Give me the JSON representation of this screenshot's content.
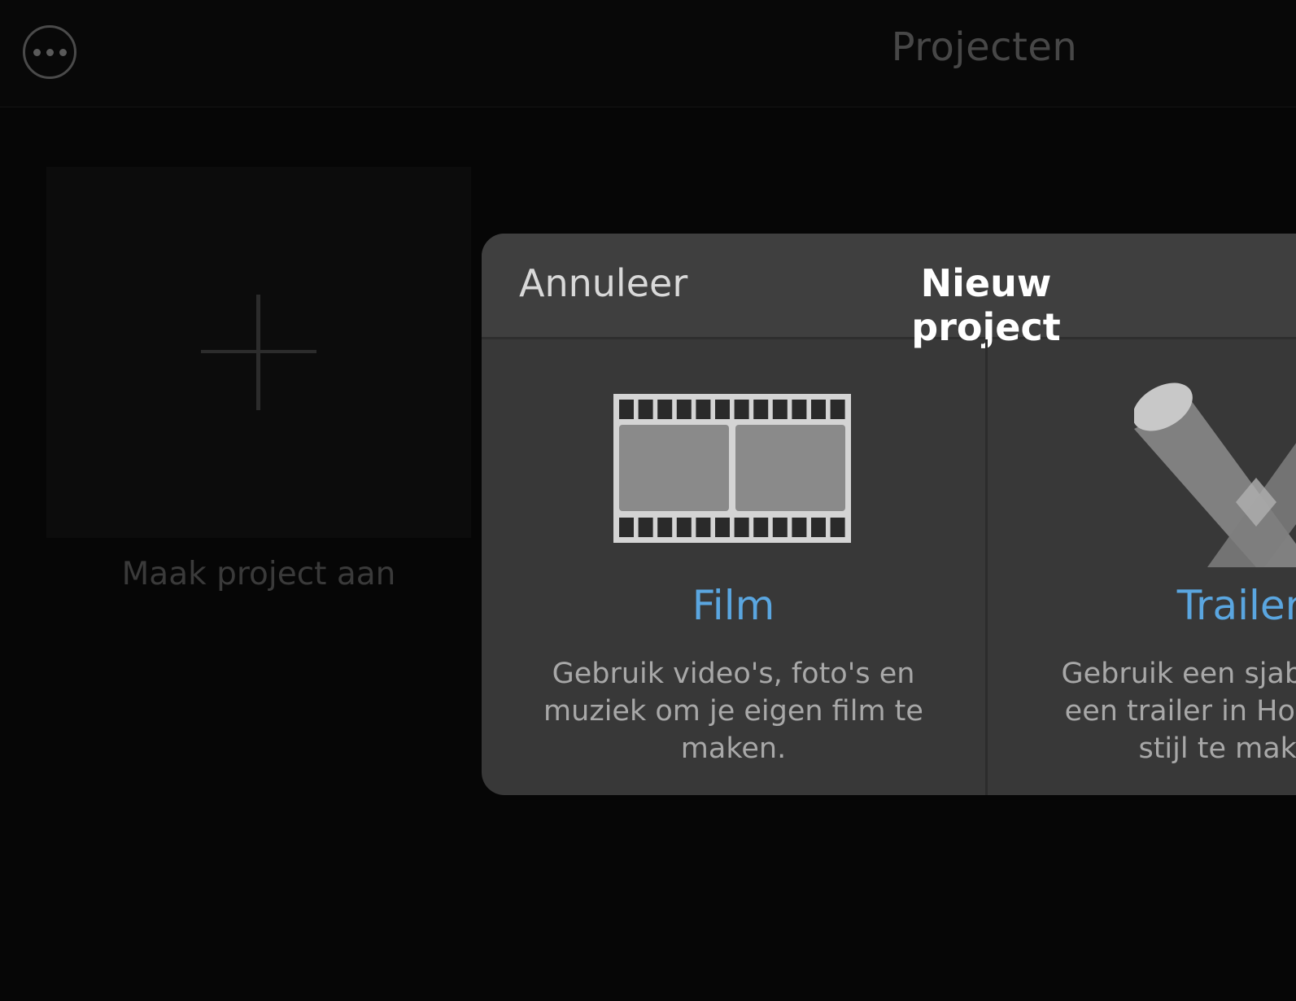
{
  "topbar": {
    "title": "Projecten",
    "more_icon": "ellipsis-circle-icon"
  },
  "create_tile": {
    "label": "Maak project aan",
    "icon": "plus-icon"
  },
  "sheet": {
    "cancel_label": "Annuleer",
    "title": "Nieuw project",
    "options": [
      {
        "name": "Film",
        "description": "Gebruik video's, foto's en muziek om je eigen film te maken.",
        "icon": "film-strip-icon"
      },
      {
        "name": "Trailer",
        "description": "Gebruik een sjabloon om een trailer in Hollywood-stijl te maken.",
        "icon": "spotlight-icon"
      }
    ]
  },
  "colors": {
    "accent": "#5aa6e0",
    "sheet_background": "#383838",
    "screen_background": "#060606"
  }
}
